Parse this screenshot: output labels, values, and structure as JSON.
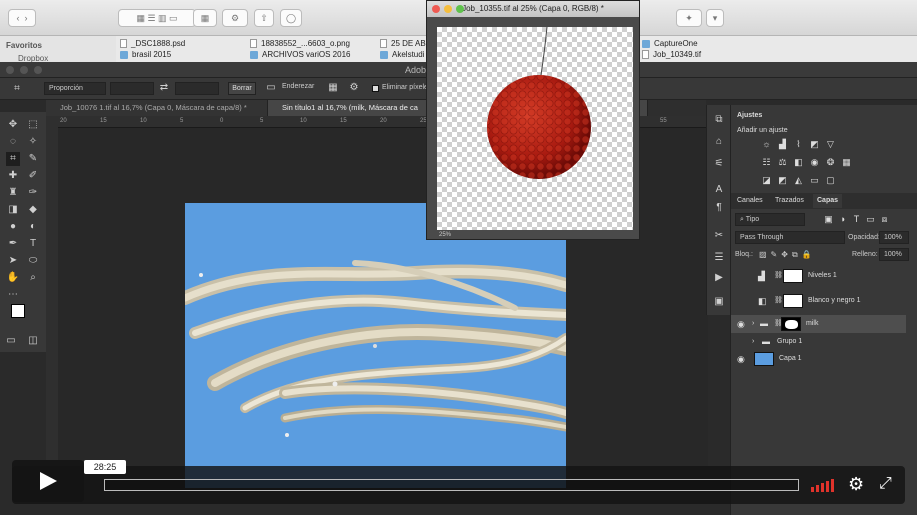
{
  "finder": {
    "sidebar_label": "Favoritos",
    "sidebar_item": "Dropbox",
    "col1": [
      "_DSC1888.psd",
      "brasil 2015"
    ],
    "col2": [
      "18838552_...6603_o.png",
      "ARCHIVOS variOS 2016"
    ],
    "col3": [
      "25 DE AB",
      "Akelstudi"
    ],
    "col4": [
      "CaptureOne",
      "Job_10349.tif"
    ]
  },
  "photoshop": {
    "app_title": "Adob",
    "options": {
      "ratio_label": "Proporción",
      "clear_button": "Borrar",
      "straighten_button": "Enderezar",
      "delete_pixels_label": "Eliminar píxele"
    },
    "tabs": [
      {
        "label": "Job_10076 1.tif al 16,7% (Capa 0, Máscara de capa/8) *"
      },
      {
        "label": "Sin título1 al 16,7% (milk, Máscara de ca"
      }
    ],
    "ruler_ticks": [
      "20",
      "15",
      "10",
      "5",
      "0",
      "5",
      "10",
      "15",
      "20",
      "25",
      "30",
      "35",
      "40",
      "45",
      "50",
      "55"
    ]
  },
  "floating_doc": {
    "title": "Job_10355.tif al 25% (Capa 0, RGB/8) *",
    "zoom": "25%"
  },
  "panels": {
    "adjustments_tab": "Ajustes",
    "add_adjustment": "Añadir un ajuste",
    "tabs": [
      "Canales",
      "Trazados",
      "Capas"
    ],
    "filter_kind": "Tipo",
    "blend_mode": "Pass Through",
    "opacity_label": "Opacidad:",
    "opacity_value": "100%",
    "lock_label": "Bloq.:",
    "fill_label": "Relleno:",
    "fill_value": "100%",
    "layers": [
      {
        "name": "Niveles 1"
      },
      {
        "name": "Blanco y negro 1"
      },
      {
        "name": "milk"
      },
      {
        "name": "Grupo 1"
      },
      {
        "name": "Capa 1"
      }
    ]
  },
  "video": {
    "time": "28:25",
    "progress": 0.0
  },
  "colors": {
    "canvas_bg": "#5b9de0",
    "volume": "#e0332b"
  }
}
